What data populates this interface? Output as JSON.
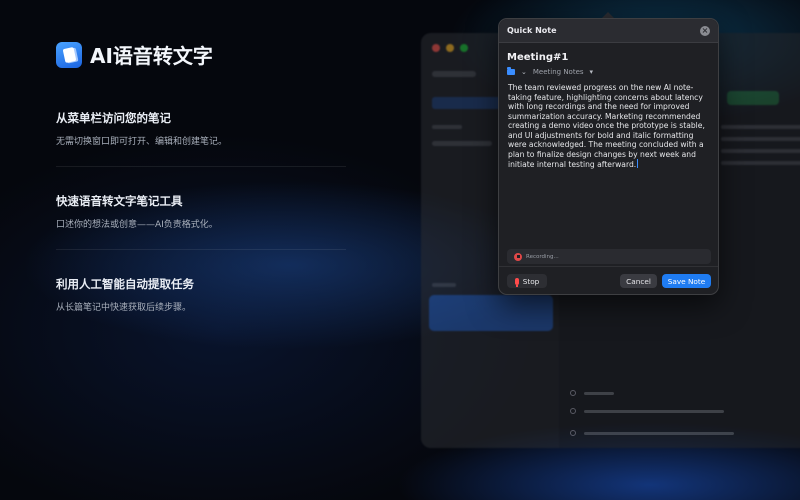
{
  "app": {
    "title": "AI语音转文字",
    "icon": "app-note-icon"
  },
  "features": [
    {
      "title": "从菜单栏访问您的笔记",
      "desc": "无需切换窗口即可打开、编辑和创建笔记。"
    },
    {
      "title": "快速语音转文字笔记工具",
      "desc": "口述你的想法或创意——AI负责格式化。"
    },
    {
      "title": "利用人工智能自动提取任务",
      "desc": "从长篇笔记中快速获取后续步骤。"
    }
  ],
  "popover": {
    "header_title": "Quick Note",
    "close_icon": "close-icon",
    "note_title": "Meeting#1",
    "folder_icon": "folder-icon",
    "folder_label": "Meeting Notes",
    "body": "The team reviewed progress on the new AI note-taking feature, highlighting concerns about latency with long recordings and the need for improved summarization accuracy. Marketing recommended creating a demo video once the prototype is stable, and UI adjustments for bold and italic formatting were acknowledged. The meeting concluded with a plan to finalize design changes by next week and initiate internal testing afterward.",
    "recording_status": "Recording...",
    "stop_label": "Stop",
    "cancel_label": "Cancel",
    "save_label": "Save Note"
  },
  "colors": {
    "accent": "#1f7cf2",
    "record": "#e04848"
  }
}
